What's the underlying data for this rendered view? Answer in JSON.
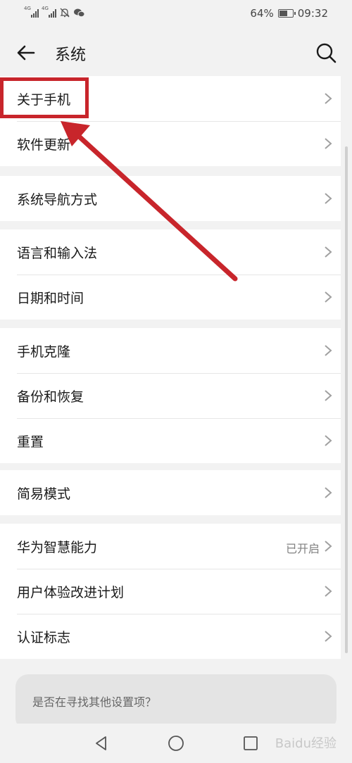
{
  "status_bar": {
    "signal_1_label": "4G",
    "signal_2_label": "4G",
    "battery_text": "64%",
    "battery_level": 0.64,
    "time": "09:32",
    "icons": [
      "mute-bell-icon",
      "wechat-icon"
    ]
  },
  "header": {
    "title": "系统",
    "back_icon": "back-arrow-icon",
    "search_icon": "search-icon"
  },
  "groups": [
    {
      "items": [
        {
          "label": "关于手机"
        },
        {
          "label": "软件更新"
        }
      ]
    },
    {
      "items": [
        {
          "label": "系统导航方式"
        }
      ]
    },
    {
      "items": [
        {
          "label": "语言和输入法"
        },
        {
          "label": "日期和时间"
        }
      ]
    },
    {
      "items": [
        {
          "label": "手机克隆"
        },
        {
          "label": "备份和恢复"
        },
        {
          "label": "重置"
        }
      ]
    },
    {
      "items": [
        {
          "label": "简易模式"
        }
      ]
    },
    {
      "items": [
        {
          "label": "华为智慧能力",
          "value": "已开启"
        },
        {
          "label": "用户体验改进计划"
        },
        {
          "label": "认证标志"
        }
      ]
    }
  ],
  "suggestion": {
    "text": "是否在寻找其他设置项？"
  },
  "navbar": {
    "back_icon": "nav-back-triangle-icon",
    "home_icon": "nav-home-circle-icon",
    "recents_icon": "nav-recents-square-icon",
    "watermark": "Baidu经验"
  },
  "annotation": {
    "color": "#c8252b",
    "target": "关于手机"
  }
}
